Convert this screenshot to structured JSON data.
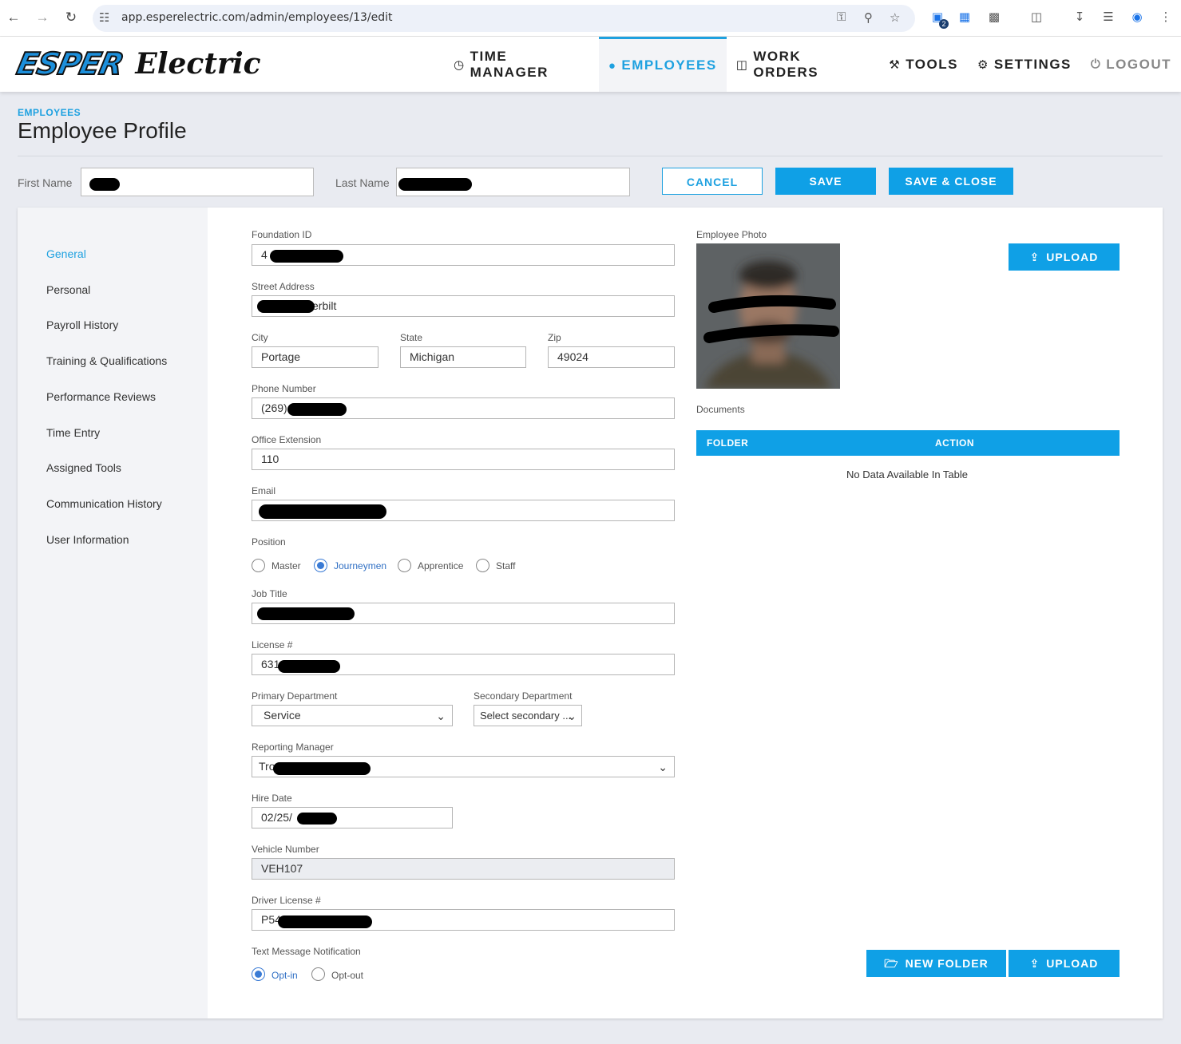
{
  "browser": {
    "url": "app.esperelectric.com/admin/employees/13/edit",
    "extension_badge": "2"
  },
  "header": {
    "logo_word1": "ESPER",
    "logo_word2": "Electric",
    "nav": [
      {
        "label": "TIME MANAGER",
        "icon": "clock-icon"
      },
      {
        "label": "EMPLOYEES",
        "icon": "user-icon"
      },
      {
        "label": "WORK ORDERS",
        "icon": "document-icon"
      },
      {
        "label": "TOOLS",
        "icon": "wrench-icon"
      },
      {
        "label": "SETTINGS",
        "icon": "gear-icon"
      },
      {
        "label": "LOGOUT",
        "icon": "power-icon"
      }
    ],
    "active_nav": "EMPLOYEES"
  },
  "page": {
    "breadcrumb": "EMPLOYEES",
    "title": "Employee Profile",
    "first_name_label": "First Name",
    "last_name_label": "Last Name",
    "cancel_label": "CANCEL",
    "save_label": "SAVE",
    "save_close_label": "SAVE & CLOSE"
  },
  "sidebar": {
    "items": [
      {
        "label": "General",
        "active": true
      },
      {
        "label": "Personal"
      },
      {
        "label": "Payroll History"
      },
      {
        "label": "Training & Qualifications"
      },
      {
        "label": "Performance Reviews"
      },
      {
        "label": "Time Entry"
      },
      {
        "label": "Assigned Tools"
      },
      {
        "label": "Communication History"
      },
      {
        "label": "User Information"
      }
    ]
  },
  "form": {
    "foundation_id": {
      "label": "Foundation ID",
      "value": "4"
    },
    "street": {
      "label": "Street Address",
      "value": "erbilt"
    },
    "city": {
      "label": "City",
      "value": "Portage"
    },
    "state": {
      "label": "State",
      "value": "Michigan"
    },
    "zip": {
      "label": "Zip",
      "value": "49024"
    },
    "phone": {
      "label": "Phone Number",
      "value": "(269)"
    },
    "office_ext": {
      "label": "Office Extension",
      "value": "110"
    },
    "email": {
      "label": "Email",
      "value": ""
    },
    "position": {
      "label": "Position",
      "options": [
        "Master",
        "Journeymen",
        "Apprentice",
        "Staff"
      ],
      "selected": "Journeymen"
    },
    "job_title": {
      "label": "Job Title",
      "value": ""
    },
    "license": {
      "label": "License #",
      "value": "631"
    },
    "primary_dept": {
      "label": "Primary Department",
      "value": "Service"
    },
    "secondary_dept": {
      "label": "Secondary Department",
      "value": "Select secondary ..."
    },
    "reporting_manager": {
      "label": "Reporting Manager",
      "value": "Tro"
    },
    "hire_date": {
      "label": "Hire Date",
      "value": "02/25/"
    },
    "vehicle": {
      "label": "Vehicle Number",
      "value": "VEH107"
    },
    "driver_license": {
      "label": "Driver License #",
      "value": "P54"
    },
    "text_notification": {
      "label": "Text Message Notification",
      "options": [
        "Opt-in",
        "Opt-out"
      ],
      "selected": "Opt-in"
    }
  },
  "right": {
    "photo_label": "Employee Photo",
    "upload_label": "UPLOAD",
    "documents_label": "Documents",
    "table_headers": [
      "FOLDER",
      "ACTION"
    ],
    "empty_message": "No Data Available In Table",
    "new_folder_label": "NEW FOLDER",
    "upload_bottom_label": "UPLOAD"
  },
  "colors": {
    "accent": "#1ea1e0",
    "button": "#0fa0e6",
    "radio": "#3a7bd5"
  }
}
